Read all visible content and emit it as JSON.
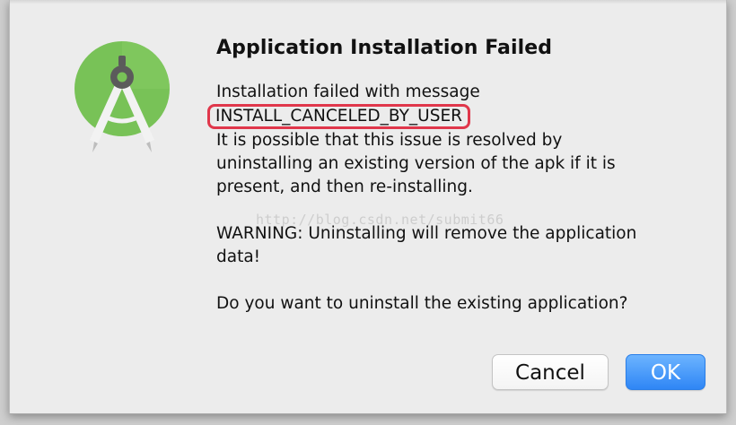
{
  "dialog": {
    "title": "Application Installation Failed",
    "lines": [
      "Installation failed with message",
      "INSTALL_CANCELED_BY_USER",
      "It is possible that this issue is resolved by",
      "uninstalling an existing version of the apk if it is",
      "present, and then re-installing."
    ],
    "warning_lines": [
      "WARNING: Uninstalling will remove the application",
      "data!"
    ],
    "question": "Do you want to uninstall the existing application?",
    "watermark": "http://blog.csdn.net/submit66",
    "icon": "android-studio-icon",
    "highlight_color": "#e0374b"
  },
  "buttons": {
    "cancel_label": "Cancel",
    "ok_label": "OK",
    "ok_color": "#2f86f5"
  }
}
